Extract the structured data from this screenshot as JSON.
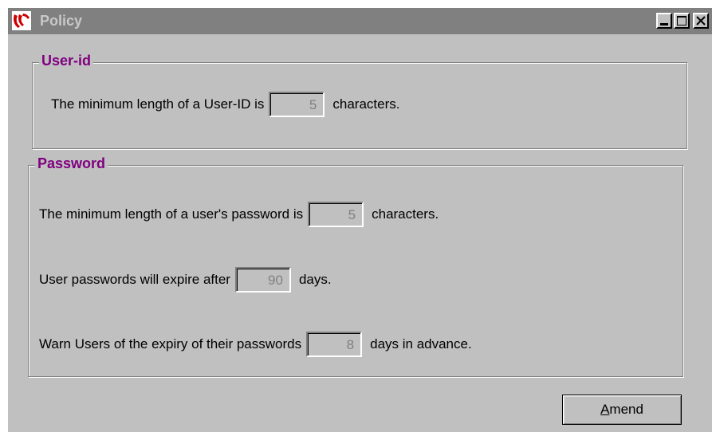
{
  "window": {
    "title": "Policy",
    "icon": "app-logo-icon",
    "controls": [
      "minimize-icon",
      "maximize-icon",
      "close-icon"
    ]
  },
  "user_id_group": {
    "title": "User-id",
    "min_length_prefix": "The minimum length of a User-ID is",
    "min_length_value": "5",
    "min_length_suffix": "characters."
  },
  "password_group": {
    "title": "Password",
    "min_length_prefix": "The minimum length of a user's password is",
    "min_length_value": "5",
    "min_length_suffix": "characters.",
    "expire_prefix": "User passwords will expire after",
    "expire_value": "90",
    "expire_suffix": "days.",
    "warn_prefix": "Warn Users of the expiry of their passwords",
    "warn_value": "8",
    "warn_suffix": "days in advance."
  },
  "buttons": {
    "amend_first": "A",
    "amend_rest": "mend"
  },
  "colors": {
    "titlebar": "#808080",
    "face": "#c0c0c0",
    "group_title": "#800080",
    "logo": "#cc0000"
  }
}
